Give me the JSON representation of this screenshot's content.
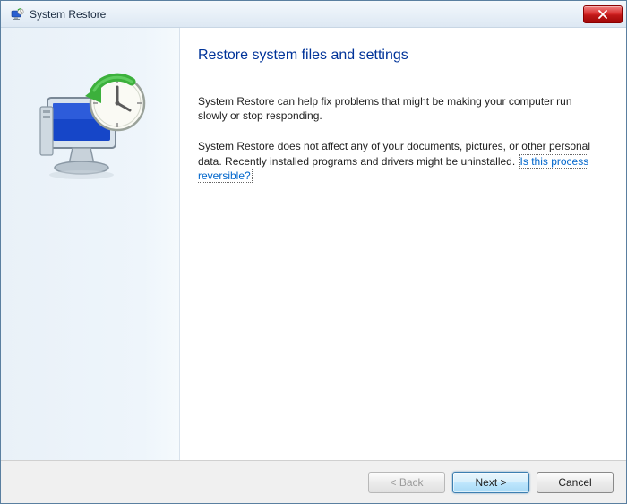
{
  "titlebar": {
    "title": "System Restore"
  },
  "main": {
    "heading": "Restore system files and settings",
    "para1": "System Restore can help fix problems that might be making your computer run slowly or stop responding.",
    "para2_prefix": "System Restore does not affect any of your documents, pictures, or other personal data. Recently installed programs and drivers might be uninstalled. ",
    "link_text": "Is this process reversible?"
  },
  "footer": {
    "back": "< Back",
    "next": "Next >",
    "cancel": "Cancel"
  },
  "icons": {
    "title_icon": "system-restore-icon",
    "close": "close-icon",
    "graphic": "monitor-clock-restore-icon"
  }
}
